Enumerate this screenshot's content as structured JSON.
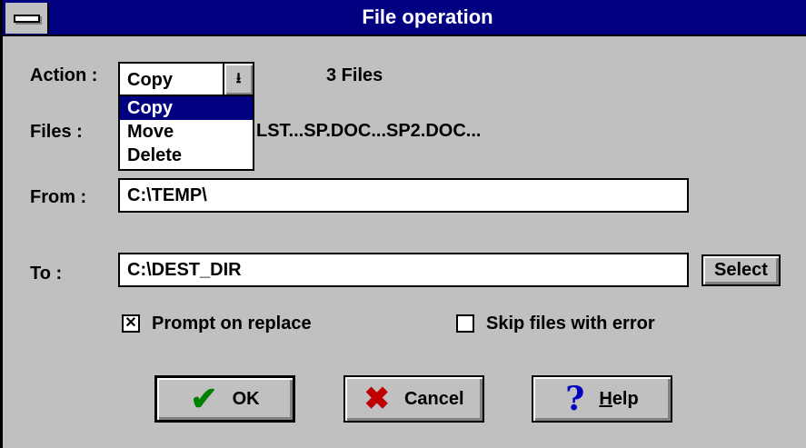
{
  "window": {
    "title": "File operation"
  },
  "action": {
    "label": "Action :",
    "value": "Copy",
    "options": [
      "Copy",
      "Move",
      "Delete"
    ],
    "selected_index": 0,
    "file_count": "3 Files"
  },
  "files": {
    "label": "Files :",
    "list_text": "LST...SP.DOC...SP2.DOC..."
  },
  "from": {
    "label": "From :",
    "value": "C:\\TEMP\\"
  },
  "to": {
    "label": "To :",
    "value": "C:\\DEST_DIR",
    "select_label": "Select"
  },
  "options": {
    "prompt_on_replace": {
      "label": "Prompt on replace",
      "checked": true,
      "mark": "✕"
    },
    "skip_files_with_error": {
      "label": "Skip files with error",
      "checked": false
    }
  },
  "buttons": {
    "ok": {
      "label": "OK",
      "icon": "check-icon"
    },
    "cancel": {
      "label": "Cancel",
      "icon": "x-icon"
    },
    "help": {
      "label_first": "H",
      "label_rest": "elp",
      "icon": "question-icon"
    }
  },
  "colors": {
    "title_bar": "#000080",
    "dialog_bg": "#c0c0c0",
    "selection": "#000080",
    "ok_icon": "#008000",
    "cancel_icon": "#c00000",
    "help_icon": "#0000c0"
  }
}
